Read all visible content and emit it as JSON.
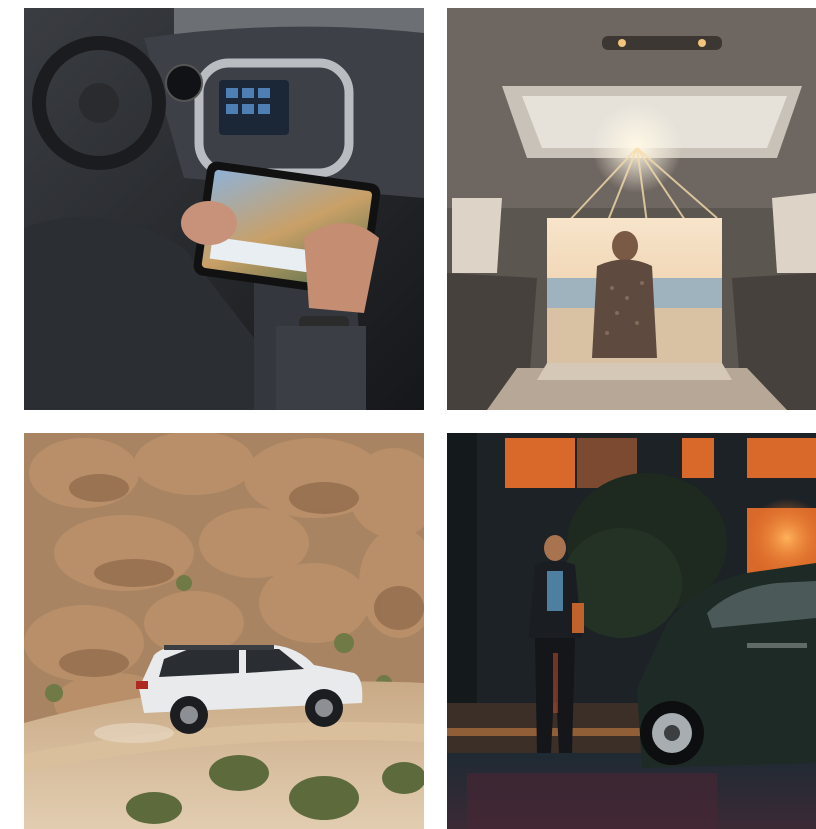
{
  "gallery": {
    "tiles": [
      {
        "id": "tablet",
        "subject": "driver-using-tablet-in-vehicle-interior",
        "colors": {
          "dash": "#2b2e33",
          "screen": "#5b7fa8"
        }
      },
      {
        "id": "cargo",
        "subject": "woman-sitting-in-open-cargo-area-facing-beach-sunset",
        "colors": {
          "sky": "#f3d9b8",
          "sea": "#9fb6c4"
        }
      },
      {
        "id": "desert",
        "subject": "white-suv-driving-desert-dirt-road-with-boulders",
        "colors": {
          "rock": "#b58a62",
          "vehicle": "#e8eaec"
        }
      },
      {
        "id": "night",
        "subject": "man-walking-to-dark-suv-at-night-in-front-of-lit-house",
        "colors": {
          "glow": "#e8742a",
          "vehicle": "#1e2a26"
        }
      }
    ]
  }
}
